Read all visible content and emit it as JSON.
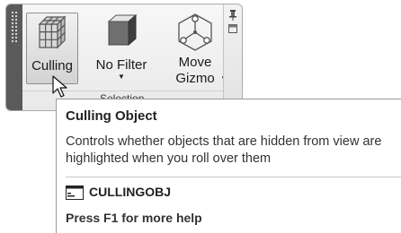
{
  "ribbon": {
    "panel_title": "Selection",
    "tools": {
      "culling": {
        "label": "Culling",
        "icon": "culling-cube-icon"
      },
      "no_filter": {
        "label": "No Filter",
        "icon": "filter-box-icon"
      },
      "move_gizmo": {
        "label_line1": "Move",
        "label_line2": "Gizmo",
        "icon": "move-gizmo-icon"
      }
    }
  },
  "tooltip": {
    "title": "Culling Object",
    "description_line1": "Controls whether objects that are hidden from view are",
    "description_line2": "highlighted when you roll over them",
    "command": "CULLINGOBJ",
    "help": "Press F1 for more help"
  },
  "colors": {
    "grip": "#5a5a5a",
    "panel_bg": "#eeeeee",
    "tooltip_bg": "#ffffff"
  }
}
